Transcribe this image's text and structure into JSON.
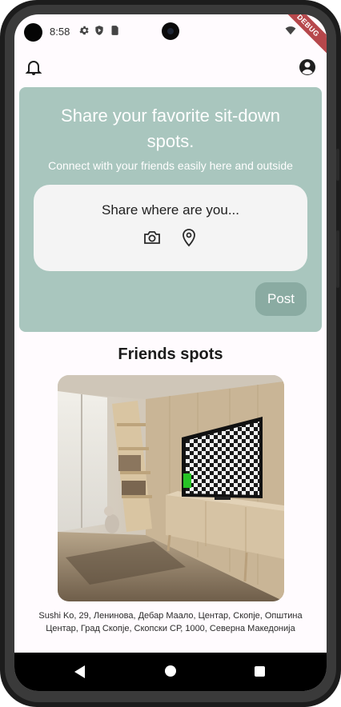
{
  "status_bar": {
    "time": "8:58",
    "debug_banner": "DEBUG",
    "icons": [
      "settings-icon",
      "shield-icon",
      "sim-card-icon",
      "wifi-icon",
      "battery-icon"
    ]
  },
  "app_bar": {
    "icons": [
      "notifications-bell-icon",
      "account-circle-icon"
    ]
  },
  "hero": {
    "title": "Share your favorite sit-down spots.",
    "subtitle": "Connect with your friends easily here and outside",
    "share_prompt": "Share where are you...",
    "post_label": "Post",
    "background_color": "#a9c6be",
    "post_button_color": "#8aaba2"
  },
  "friends": {
    "title": "Friends spots",
    "items": [
      {
        "photo_icon": "room-photo",
        "address": "Sushi Ko, 29, Ленинова, Дебар Маало, Центар, Скопје, Општина Центар, Град Скопје, Скопски СР, 1000, Северна Македонија"
      }
    ]
  },
  "nav_bar": {
    "icons": [
      "back-triangle-icon",
      "home-circle-icon",
      "recents-square-icon"
    ]
  }
}
